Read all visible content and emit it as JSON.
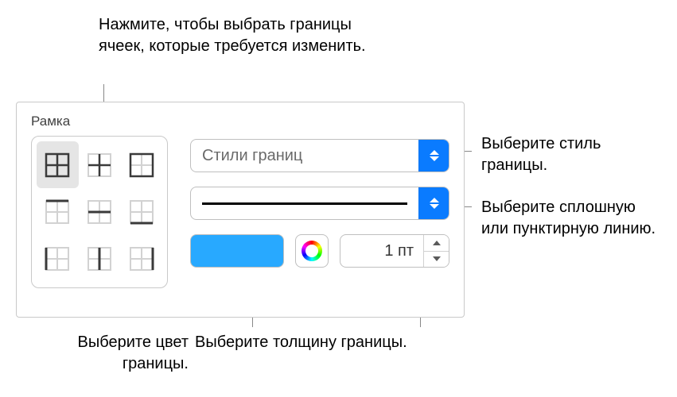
{
  "callouts": {
    "top": "Нажмите, чтобы выбрать границы ячеек, которые требуется изменить.",
    "right1": "Выберите стиль границы.",
    "right2": "Выберите сплошную или пунктирную линию.",
    "bottom1": "Выберите цвет границы.",
    "bottom2": "Выберите толщину границы."
  },
  "panel": {
    "title": "Рамка",
    "styles_label": "Стили границ",
    "thickness_value": "1 пт",
    "border_color": "#28a9ff"
  }
}
